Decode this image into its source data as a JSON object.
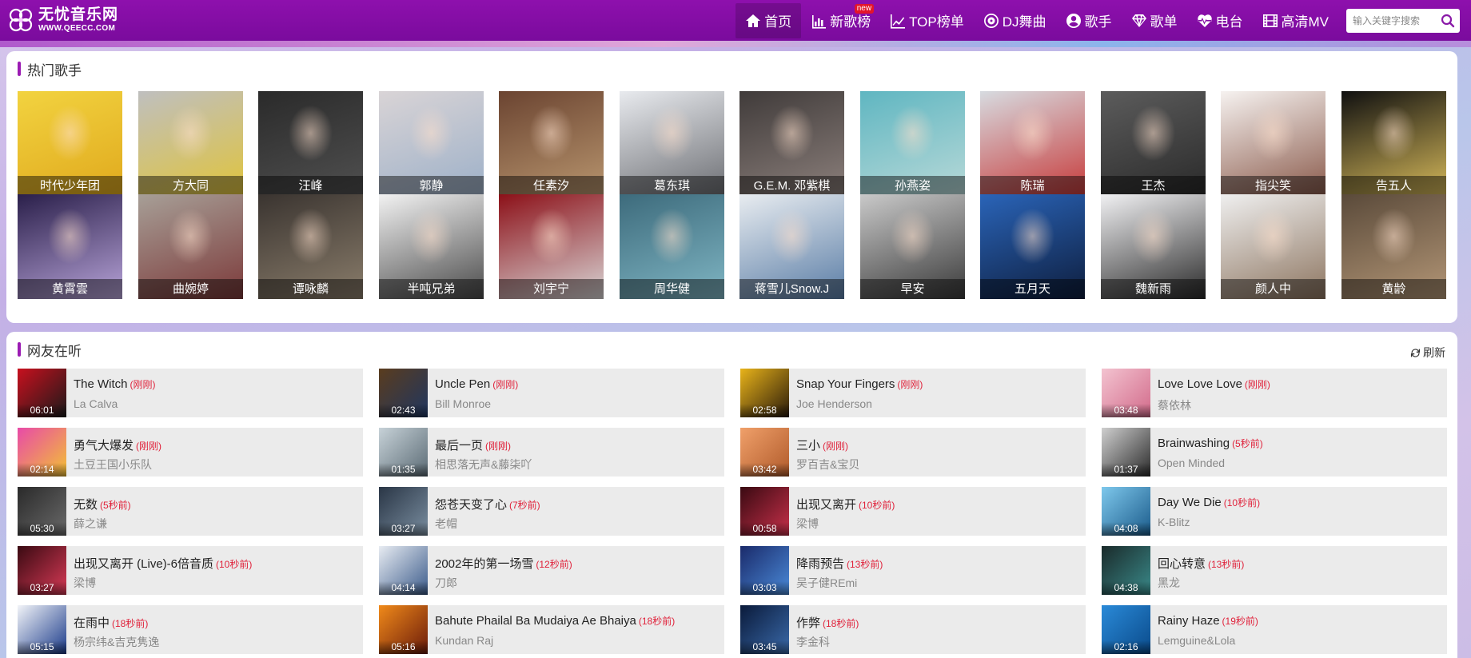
{
  "logo": {
    "cn": "无忧音乐网",
    "en": "WWW.QEECC.COM"
  },
  "nav": [
    {
      "label": "首页",
      "icon": "home-icon"
    },
    {
      "label": "新歌榜",
      "icon": "bar-chart-icon",
      "badge": "new"
    },
    {
      "label": "TOP榜单",
      "icon": "trend-icon"
    },
    {
      "label": "DJ舞曲",
      "icon": "disc-icon"
    },
    {
      "label": "歌手",
      "icon": "user-icon"
    },
    {
      "label": "歌单",
      "icon": "diamond-icon"
    },
    {
      "label": "电台",
      "icon": "heartbeat-icon"
    },
    {
      "label": "高清MV",
      "icon": "film-icon"
    }
  ],
  "search": {
    "placeholder": "输入关键字搜索"
  },
  "hot_singers": {
    "title": "热门歌手",
    "items": [
      {
        "name": "时代少年团",
        "c1": "#f2d340",
        "c2": "#e0a91d"
      },
      {
        "name": "方大同",
        "c1": "#bfbfbf",
        "c2": "#e0c43c"
      },
      {
        "name": "汪峰",
        "c1": "#2a2a2a",
        "c2": "#505050"
      },
      {
        "name": "郭静",
        "c1": "#d9d4d6",
        "c2": "#9db0c8"
      },
      {
        "name": "任素汐",
        "c1": "#6b4431",
        "c2": "#b8956e"
      },
      {
        "name": "葛东琪",
        "c1": "#e8eaee",
        "c2": "#6d6f74"
      },
      {
        "name": "G.E.M. 邓紫棋",
        "c1": "#403b3a",
        "c2": "#8b7f7b"
      },
      {
        "name": "孙燕姿",
        "c1": "#5fb6c1",
        "c2": "#b8d9d8"
      },
      {
        "name": "陈瑞",
        "c1": "#d7dbe0",
        "c2": "#c73b3b"
      },
      {
        "name": "王杰",
        "c1": "#5c5c5c",
        "c2": "#2a2a2a"
      },
      {
        "name": "指尖笑",
        "c1": "#f6f2f0",
        "c2": "#8a5a4b"
      },
      {
        "name": "告五人",
        "c1": "#101010",
        "c2": "#d6b95a"
      },
      {
        "name": "黄霄雲",
        "c1": "#2a1f4a",
        "c2": "#b7a3d8"
      },
      {
        "name": "曲婉婷",
        "c1": "#a79f97",
        "c2": "#7c3a3a"
      },
      {
        "name": "谭咏麟",
        "c1": "#3a3430",
        "c2": "#8a7d6b"
      },
      {
        "name": "半吨兄弟",
        "c1": "#f2f2f2",
        "c2": "#4a4a4a"
      },
      {
        "name": "刘宇宁",
        "c1": "#8c1018",
        "c2": "#d8d4d4"
      },
      {
        "name": "周华健",
        "c1": "#3d6b7c",
        "c2": "#7fb5c3"
      },
      {
        "name": "蒋雪儿Snow.J",
        "c1": "#e8ecf0",
        "c2": "#5a7da6"
      },
      {
        "name": "早安",
        "c1": "#c9c9c9",
        "c2": "#3a3a3a"
      },
      {
        "name": "五月天",
        "c1": "#2a64b8",
        "c2": "#0e1e3e"
      },
      {
        "name": "魏新雨",
        "c1": "#f1f1f3",
        "c2": "#2a2a2a"
      },
      {
        "name": "颜人中",
        "c1": "#efefef",
        "c2": "#8d7560"
      },
      {
        "name": "黄龄",
        "c1": "#5a4a3a",
        "c2": "#b39676"
      }
    ]
  },
  "listening": {
    "title": "网友在听",
    "refresh_label": "刷新",
    "tracks": [
      {
        "title": "The Witch",
        "ago": "(刚刚)",
        "artist": "La Calva",
        "duration": "06:01",
        "c1": "#c8101e",
        "c2": "#1a1a1a"
      },
      {
        "title": "Uncle Pen",
        "ago": "(刚刚)",
        "artist": "Bill Monroe",
        "duration": "02:43",
        "c1": "#5a3c1e",
        "c2": "#1f3660"
      },
      {
        "title": "Snap Your Fingers",
        "ago": "(刚刚)",
        "artist": "Joe Henderson",
        "duration": "02:58",
        "c1": "#e8b31a",
        "c2": "#2a1a0a"
      },
      {
        "title": "Love Love Love",
        "ago": "(刚刚)",
        "artist": "蔡依林",
        "duration": "03:48",
        "c1": "#f3c3d0",
        "c2": "#d26a8a"
      },
      {
        "title": "勇气大爆发",
        "ago": "(刚刚)",
        "artist": "土豆王国小乐队",
        "duration": "02:14",
        "c1": "#e84aa8",
        "c2": "#f3c233"
      },
      {
        "title": "最后一页",
        "ago": "(刚刚)",
        "artist": "相思落无声&藤柒吖",
        "duration": "01:35",
        "c1": "#c7d2d8",
        "c2": "#5a6a74"
      },
      {
        "title": "三小",
        "ago": "(刚刚)",
        "artist": "罗百吉&宝贝",
        "duration": "03:42",
        "c1": "#f0a06a",
        "c2": "#b05a2a"
      },
      {
        "title": "Brainwashing",
        "ago": "(5秒前)",
        "artist": "Open Minded",
        "duration": "01:37",
        "c1": "#cfcfcf",
        "c2": "#2a2a2a"
      },
      {
        "title": "无数",
        "ago": "(5秒前)",
        "artist": "薛之谦",
        "duration": "05:30",
        "c1": "#2a2a2a",
        "c2": "#6a6a6a"
      },
      {
        "title": "怨苍天变了心",
        "ago": "(7秒前)",
        "artist": "老帽",
        "duration": "03:27",
        "c1": "#2a3646",
        "c2": "#7a8ea0"
      },
      {
        "title": "出现又离开",
        "ago": "(10秒前)",
        "artist": "梁博",
        "duration": "00:58",
        "c1": "#3a0a12",
        "c2": "#c8304a"
      },
      {
        "title": "Day We Die",
        "ago": "(10秒前)",
        "artist": "K-Blitz",
        "duration": "04:08",
        "c1": "#7ec8ec",
        "c2": "#1a5a8a"
      },
      {
        "title": "出现又离开 (Live)-6倍音质",
        "ago": "(10秒前)",
        "artist": "梁博",
        "duration": "03:27",
        "c1": "#3a0a12",
        "c2": "#d83a56"
      },
      {
        "title": "2002年的第一场雪",
        "ago": "(12秒前)",
        "artist": "刀郎",
        "duration": "04:14",
        "c1": "#e8ecf2",
        "c2": "#3a5a8a"
      },
      {
        "title": "降雨预告",
        "ago": "(13秒前)",
        "artist": "吴子健REmi",
        "duration": "03:03",
        "c1": "#1a2a6a",
        "c2": "#4a8ad8"
      },
      {
        "title": "回心转意",
        "ago": "(13秒前)",
        "artist": "黑龙",
        "duration": "04:38",
        "c1": "#1a2a2a",
        "c2": "#3a8a8a"
      },
      {
        "title": "在雨中",
        "ago": "(18秒前)",
        "artist": "杨宗纬&吉克隽逸",
        "duration": "05:15",
        "c1": "#f2f4f8",
        "c2": "#1a3a8a"
      },
      {
        "title": "Bahute Phailal Ba Mudaiya Ae Bhaiya",
        "ago": "(18秒前)",
        "artist": "Kundan Raj",
        "duration": "05:16",
        "c1": "#f08a1a",
        "c2": "#6a1a0a"
      },
      {
        "title": "作弊",
        "ago": "(18秒前)",
        "artist": "李金科",
        "duration": "03:45",
        "c1": "#0a1a3a",
        "c2": "#3a6aaa"
      },
      {
        "title": "Rainy Haze",
        "ago": "(19秒前)",
        "artist": "Lemguine&Lola",
        "duration": "02:16",
        "c1": "#2a8ad8",
        "c2": "#0a4a8a"
      }
    ]
  }
}
